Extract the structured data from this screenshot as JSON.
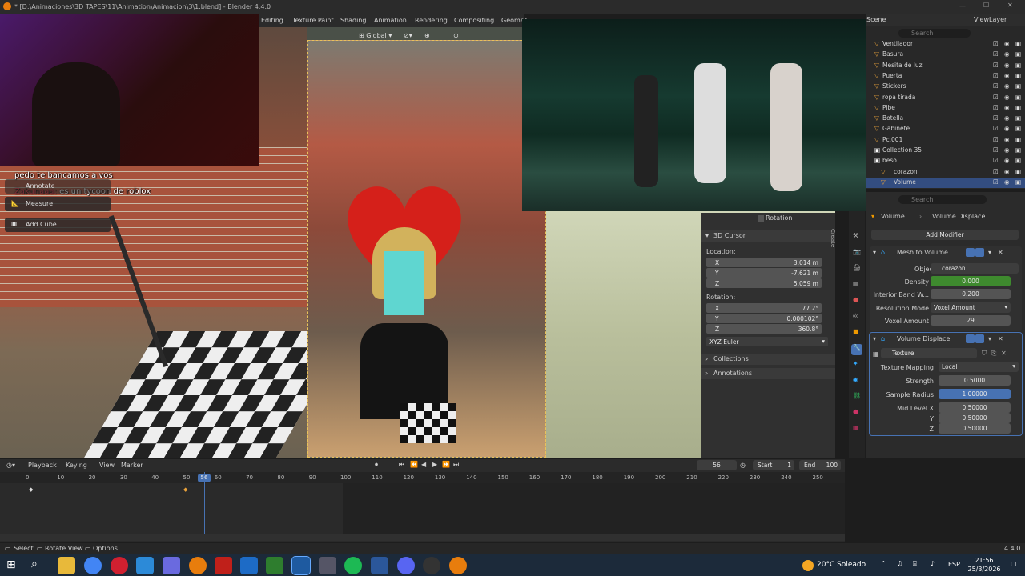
{
  "window": {
    "title": "* [D:\\Animaciones\\3D TAPES\\11\\Animation\\Animacion\\3\\1.blend] - Blender 4.4.0"
  },
  "workspaces": [
    "Editing",
    "Texture Paint",
    "Shading",
    "Animation",
    "Rendering",
    "Compositing",
    "Geomet"
  ],
  "viewport_header": {
    "orientation": "Global"
  },
  "chat": [
    {
      "user": "",
      "text": "pedo te bancamos a vos"
    },
    {
      "user": "Zakunaaa:",
      "text": "es un tycoon de roblox"
    }
  ],
  "tools": {
    "annotate": "Annotate",
    "measure": "Measure",
    "add_cube": "Add Cube"
  },
  "npanel": {
    "rotation_top": "Rotation",
    "cursor_title": "3D Cursor",
    "location_label": "Location:",
    "loc": [
      {
        "axis": "X",
        "value": "3.014 m"
      },
      {
        "axis": "Y",
        "value": "-7.621 m"
      },
      {
        "axis": "Z",
        "value": "5.059 m"
      }
    ],
    "rotation_label": "Rotation:",
    "rot": [
      {
        "axis": "X",
        "value": "77.2°"
      },
      {
        "axis": "Y",
        "value": "0.000102°"
      },
      {
        "axis": "Z",
        "value": "360.8°"
      }
    ],
    "mode": "XYZ Euler",
    "collections": "Collections",
    "annotations": "Annotations",
    "side_tab": "Create"
  },
  "outliner": {
    "scene": "Scene",
    "view_layer": "ViewLayer",
    "search_placeholder": "Search",
    "items": [
      "Ventilador",
      "Basura",
      "Mesita de luz",
      "Puerta",
      "Stickers",
      "ropa tirada",
      "Pibe",
      "Botella",
      "Gabinete",
      "Pc.001",
      "Collection 35",
      "beso",
      "corazon",
      "Volume"
    ]
  },
  "properties": {
    "search_placeholder": "Search",
    "object": "Volume",
    "modifier": "Volume Displace",
    "add_modifier": "Add Modifier",
    "mesh_to_volume": {
      "title": "Mesh to Volume",
      "object_label": "Object",
      "object_value": "corazon",
      "density_label": "Density",
      "density_value": "0.000",
      "band_label": "Interior Band W...",
      "band_value": "0.200",
      "resmode_label": "Resolution Mode",
      "resmode_value": "Voxel Amount",
      "voxel_label": "Voxel Amount",
      "voxel_value": "29"
    },
    "volume_displace": {
      "title": "Volume Displace",
      "texture_label": "Texture",
      "mapping_label": "Texture Mapping",
      "mapping_value": "Local",
      "strength_label": "Strength",
      "strength_value": "0.5000",
      "radius_label": "Sample Radius",
      "radius_value": "1.00000",
      "mid_x_label": "Mid Level X",
      "mid_x_value": "0.50000",
      "mid_y_label": "Y",
      "mid_y_value": "0.50000",
      "mid_z_label": "Z",
      "mid_z_value": "0.50000"
    }
  },
  "timeline": {
    "menus": [
      "Playback",
      "Keying",
      "View",
      "Marker"
    ],
    "current_frame": "56",
    "start_label": "Start",
    "start": "1",
    "end_label": "End",
    "end": "100",
    "ticks": [
      "0",
      "10",
      "20",
      "30",
      "40",
      "50",
      "60",
      "70",
      "80",
      "90",
      "100",
      "110",
      "120",
      "130",
      "140",
      "150",
      "160",
      "170",
      "180",
      "190",
      "200",
      "210",
      "220",
      "230",
      "240",
      "250"
    ]
  },
  "statusbar": {
    "select": "Select",
    "rotate": "Rotate View",
    "options": "Options",
    "version": "4.4.0"
  },
  "taskbar": {
    "weather": "20°C Soleado",
    "lang": "ESP",
    "time": "21:56",
    "date": "25/3/2026"
  },
  "colors": {
    "accent": "#4772b3",
    "green_field": "#3e8a2e",
    "red_heart": "#d5201a"
  }
}
